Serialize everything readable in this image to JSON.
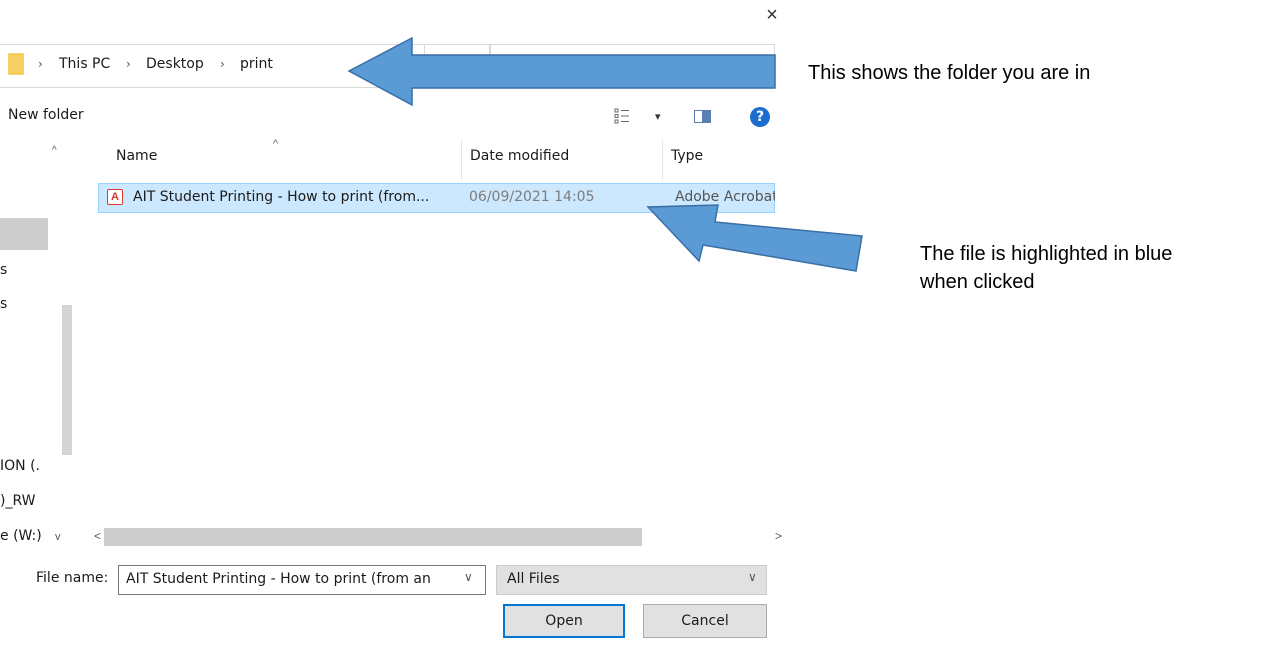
{
  "dialog": {
    "close_glyph": "×",
    "breadcrumb": [
      "This PC",
      "Desktop",
      "print"
    ],
    "breadcrumb_sep": "›",
    "toolbar": {
      "new_folder_label": "New folder",
      "help_glyph": "?",
      "view_dropdown_glyph": "▾"
    },
    "left_nav": {
      "fragments": [
        "s",
        "s",
        "ION (.",
        ")_RW"
      ],
      "drive_w": "e (W:)",
      "scroll_up_glyph": "^",
      "scroll_down_glyph": "v"
    },
    "columns": {
      "name": "Name",
      "date_modified": "Date modified",
      "type": "Type",
      "sort_glyph": "^"
    },
    "files": [
      {
        "name": "AIT Student Printing - How to print (from...",
        "date_modified": "06/09/2021 14:05",
        "type": "Adobe Acrobat",
        "selected": true,
        "icon": "pdf-icon"
      }
    ],
    "hscroll": {
      "left_glyph": "<",
      "right_glyph": ">"
    },
    "footer": {
      "file_name_label": "File name:",
      "file_name_value": "AIT Student Printing - How to print (from an",
      "filter_value": "All Files",
      "chevron_glyph": "∨",
      "open_label": "Open",
      "cancel_label": "Cancel"
    }
  },
  "annotations": {
    "folder_note": "This shows the folder you are in",
    "file_note_line1": "The file is highlighted in blue",
    "file_note_line2": "when clicked"
  },
  "colors": {
    "selection_fill": "#cce8ff",
    "selection_border": "#99d1ff",
    "arrow_fill": "#5b9bd5",
    "arrow_stroke": "#3a6ea5",
    "pdf_red": "#d83b2b",
    "help_blue": "#1c6dd0",
    "folder_yellow": "#f5cf62"
  }
}
